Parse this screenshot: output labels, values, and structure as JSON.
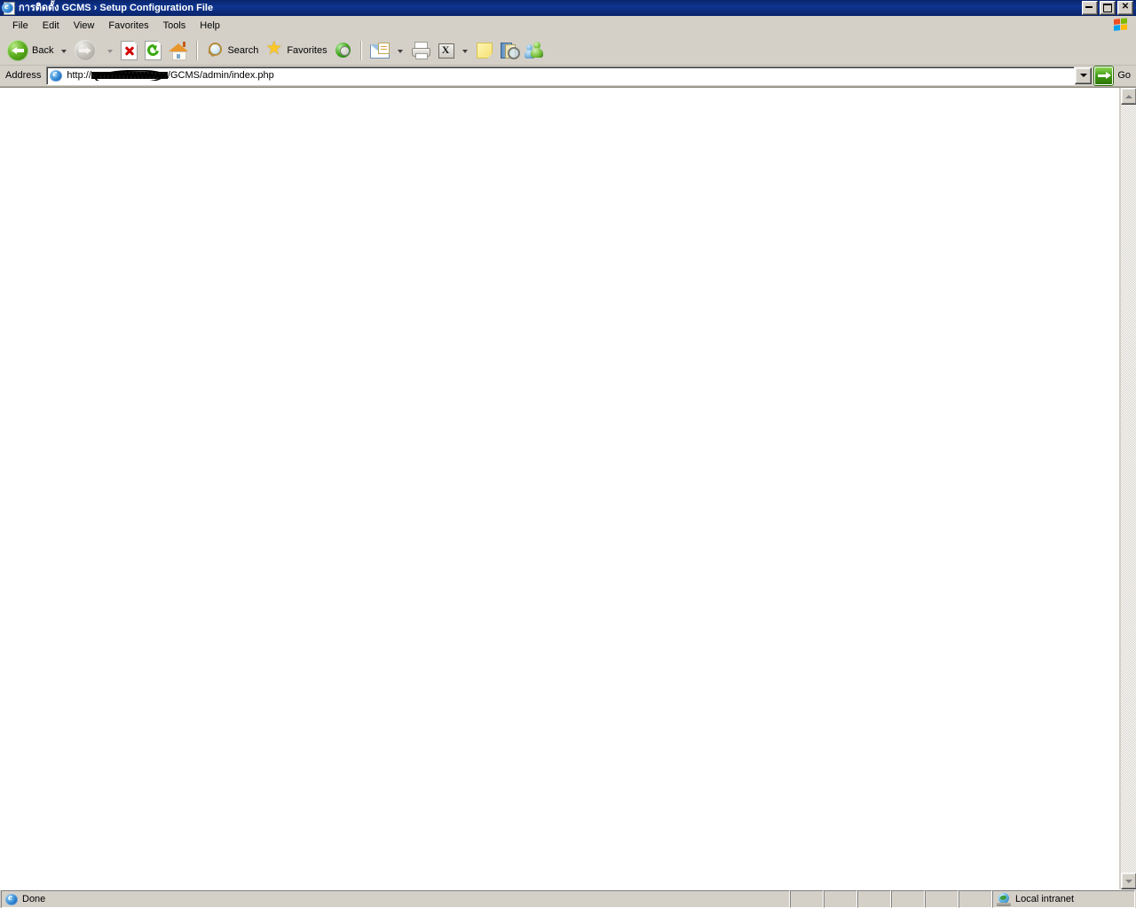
{
  "window": {
    "title": "การติดตั้ง GCMS › Setup Configuration File",
    "icon": "ie-document-icon",
    "minimize_label": "Minimize",
    "maximize_label": "Restore",
    "close_label": "Close",
    "close_glyph": "✕"
  },
  "menu": {
    "items": [
      {
        "label": "File",
        "name": "menu-item-file"
      },
      {
        "label": "Edit",
        "name": "menu-item-edit"
      },
      {
        "label": "View",
        "name": "menu-item-view"
      },
      {
        "label": "Favorites",
        "name": "menu-item-favorites"
      },
      {
        "label": "Tools",
        "name": "menu-item-tools"
      },
      {
        "label": "Help",
        "name": "menu-item-help"
      }
    ],
    "logo": "windows-flag-logo"
  },
  "toolbar": {
    "back_label": "Back",
    "forward_label": "",
    "stop_label": "",
    "refresh_label": "",
    "home_label": "",
    "search_label": "Search",
    "favorites_label": "Favorites",
    "media_label": "",
    "mail_label": "",
    "print_label": "",
    "edit_label": "",
    "edit_glyph": "X",
    "notes_label": "",
    "research_label": "",
    "messenger_label": ""
  },
  "address": {
    "label": "Address",
    "scheme_text": "http://",
    "host_text": "",
    "path_text": "/GCMS/admin/index.php",
    "full_value": "http://[redacted]/GCMS/admin/index.php",
    "go_label": "Go",
    "dropdown_name": "address-history-dropdown"
  },
  "page": {
    "body_text": "",
    "background": "#ffffff"
  },
  "statusbar": {
    "status_text": "Done",
    "zone_text": "Local intranet",
    "empty_panes": 6
  },
  "colors": {
    "titlebar": "#0a246a",
    "chrome": "#d4d0c8",
    "page_bg": "#ffffff",
    "accent_green": "#3f9a11"
  }
}
